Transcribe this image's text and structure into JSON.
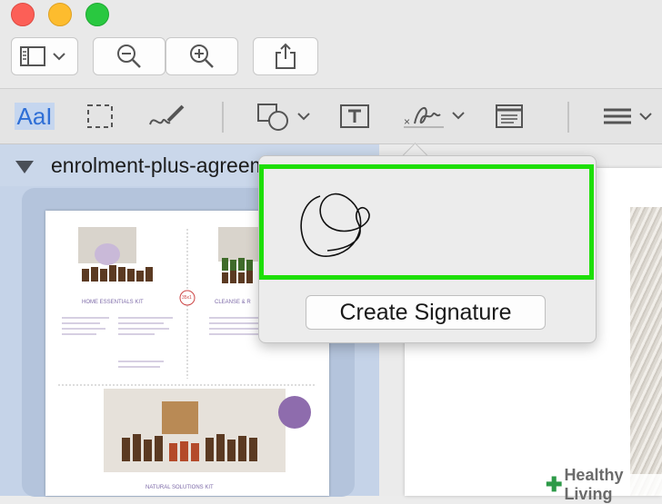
{
  "window": {
    "traffic_lights": [
      "close",
      "minimize",
      "zoom"
    ]
  },
  "toolbar": {
    "buttons": [
      {
        "name": "sidebar-toggle",
        "icon": "sidebar-icon"
      },
      {
        "name": "zoom-out",
        "icon": "zoom-out-icon"
      },
      {
        "name": "zoom-in",
        "icon": "zoom-in-icon"
      },
      {
        "name": "share",
        "icon": "share-icon"
      }
    ]
  },
  "markup_toolbar": {
    "text_selection_label": "AaI",
    "tools": [
      "text-selection",
      "rectangular-selection",
      "sketch",
      "shapes",
      "text-box",
      "sign",
      "note",
      "line-style"
    ]
  },
  "sidebar": {
    "filename": "enrolment-plus-agreement.pdf"
  },
  "thumbnail": {
    "home_kit_title": "HOME ESSENTIALS KIT",
    "cleanse_title": "CLEANSE & R",
    "natural_kit_title": "NATURAL SOLUTIONS KIT",
    "price_badge": "35x1"
  },
  "signature_popover": {
    "create_button_label": "Create Signature"
  },
  "watermark": {
    "text": "Healthy Living"
  },
  "colors": {
    "highlight_green": "#1ddf07",
    "sidebar_blue": "#c5d3e8",
    "accent_blue": "#2f6fd6"
  }
}
